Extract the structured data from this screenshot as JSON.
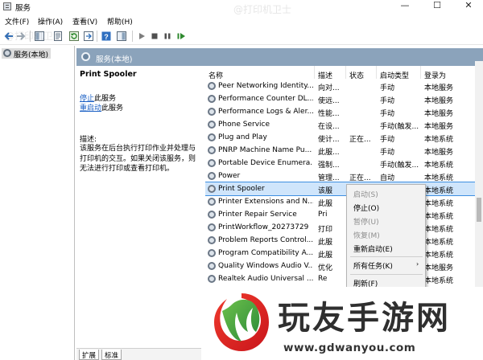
{
  "window": {
    "title": "服务",
    "minimize": "—",
    "maximize": "☐",
    "close": "✕"
  },
  "menu": [
    "文件(F)",
    "操作(A)",
    "查看(V)",
    "帮助(H)"
  ],
  "tree": {
    "root": "服务(本地)"
  },
  "header": {
    "title": "服务(本地)"
  },
  "details": {
    "service_name": "Print Spooler",
    "stop_link": "停止",
    "stop_suffix": "此服务",
    "restart_link": "重启动",
    "restart_suffix": "此服务",
    "desc_label": "描述:",
    "desc_text": "该服务在后台执行打印作业并处理与打印机的交互。如果关闭该服务，则无法进行打印或查看打印机。"
  },
  "columns": [
    "名称",
    "描述",
    "状态",
    "启动类型",
    "登录为"
  ],
  "services": [
    {
      "name": "Peer Networking Identity...",
      "desc": "向对...",
      "status": "",
      "startup": "手动",
      "logon": "本地服务"
    },
    {
      "name": "Performance Counter DL...",
      "desc": "使远...",
      "status": "",
      "startup": "手动",
      "logon": "本地服务"
    },
    {
      "name": "Performance Logs & Aler...",
      "desc": "性能...",
      "status": "",
      "startup": "手动",
      "logon": "本地服务"
    },
    {
      "name": "Phone Service",
      "desc": "在设...",
      "status": "",
      "startup": "手动(触发...",
      "logon": "本地服务"
    },
    {
      "name": "Plug and Play",
      "desc": "使计...",
      "status": "正在...",
      "startup": "手动",
      "logon": "本地系统"
    },
    {
      "name": "PNRP Machine Name Pu...",
      "desc": "此服...",
      "status": "",
      "startup": "手动",
      "logon": "本地服务"
    },
    {
      "name": "Portable Device Enumera...",
      "desc": "强制...",
      "status": "",
      "startup": "手动(触发...",
      "logon": "本地系统"
    },
    {
      "name": "Power",
      "desc": "管理...",
      "status": "正在...",
      "startup": "自动",
      "logon": "本地系统"
    },
    {
      "name": "Print Spooler",
      "desc": "该服",
      "status": "",
      "startup": "",
      "logon": "本地系统"
    },
    {
      "name": "Printer Extensions and N...",
      "desc": "此服",
      "status": "",
      "startup": "",
      "logon": "本地系统"
    },
    {
      "name": "Printer Repair Service",
      "desc": "Pri",
      "status": "",
      "startup": "",
      "logon": "本地系统"
    },
    {
      "name": "PrintWorkflow_20273729",
      "desc": "打印",
      "status": "",
      "startup": "",
      "logon": "本地系统"
    },
    {
      "name": "Problem Reports Control...",
      "desc": "此服",
      "status": "",
      "startup": "",
      "logon": "本地系统"
    },
    {
      "name": "Program Compatibility A...",
      "desc": "此服",
      "status": "",
      "startup": "",
      "logon": "本地系统"
    },
    {
      "name": "Quality Windows Audio V...",
      "desc": "优化",
      "status": "",
      "startup": "",
      "logon": "本地服务"
    },
    {
      "name": "Realtek Audio Universal ...",
      "desc": "Re",
      "status": "",
      "startup": "",
      "logon": "本地系统"
    }
  ],
  "context_menu": {
    "items": [
      {
        "label": "启动(S)",
        "disabled": true
      },
      {
        "label": "停止(O)",
        "disabled": false
      },
      {
        "label": "暂停(U)",
        "disabled": true
      },
      {
        "label": "恢复(M)",
        "disabled": true
      },
      {
        "label": "重新启动(E)",
        "disabled": false
      },
      {
        "label": "所有任务(K)",
        "disabled": false
      },
      {
        "label": "刷新(F)",
        "disabled": false
      }
    ],
    "submenu_arrow": "›"
  },
  "bottom_tabs": [
    "扩展",
    "标准"
  ],
  "watermark": {
    "text": "@打印机卫士"
  },
  "branding": {
    "name": "玩友手游网",
    "url": "www.gdwanyou.com"
  },
  "colors": {
    "header": "#8ba3bb",
    "selection": "#cfe5fb",
    "link": "#1a5fc4"
  }
}
